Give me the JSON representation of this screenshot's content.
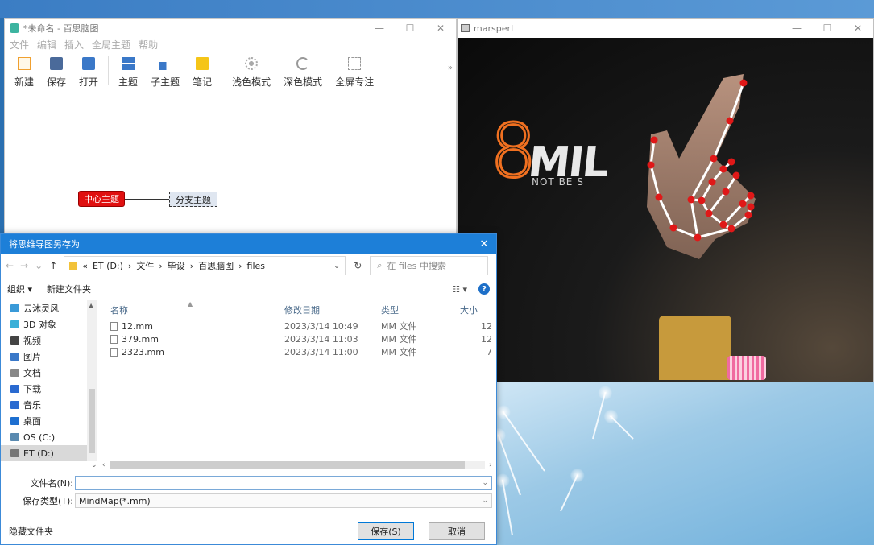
{
  "mindmap_window": {
    "title": "*未命名 - 百思脑图",
    "controls": {
      "minimize": "—",
      "maximize": "☐",
      "close": "✕"
    },
    "menu": [
      "文件",
      "编辑",
      "插入",
      "全局主题",
      "帮助"
    ],
    "toolbar": {
      "new": "新建",
      "save": "保存",
      "open": "打开",
      "topic": "主题",
      "subtopic": "子主题",
      "note": "笔记",
      "light": "浅色模式",
      "dark": "深色模式",
      "fullscreen": "全屏专注",
      "more": "»"
    },
    "nodes": {
      "main": "中心主题",
      "branch": "分支主题"
    }
  },
  "camera_window": {
    "title": "marsperL",
    "controls": {
      "minimize": "—",
      "maximize": "☐",
      "close": "✕"
    },
    "digit": "8",
    "shirt_text": "MIL",
    "shirt_sub": "NOT BE S"
  },
  "save_dialog": {
    "title": "将思维导图另存为",
    "close": "✕",
    "address": {
      "prefix": "«",
      "crumbs": [
        "ET (D:)",
        "文件",
        "毕设",
        "百思脑图",
        "files"
      ],
      "sep": "›"
    },
    "search_placeholder": "在 files 中搜索",
    "organize": "组织 ▾",
    "new_folder": "新建文件夹",
    "nav_items": [
      {
        "label": "云沐灵风",
        "color": "#3a9ad8"
      },
      {
        "label": "3D 对象",
        "color": "#3ab0d8"
      },
      {
        "label": "视频",
        "color": "#444444"
      },
      {
        "label": "图片",
        "color": "#3a78c8"
      },
      {
        "label": "文档",
        "color": "#888888"
      },
      {
        "label": "下载",
        "color": "#2a6ad0"
      },
      {
        "label": "音乐",
        "color": "#2a6ad0"
      },
      {
        "label": "桌面",
        "color": "#1e6fd0"
      },
      {
        "label": "OS (C:)",
        "color": "#5a8ab0"
      },
      {
        "label": "ET (D:)",
        "color": "#777777"
      }
    ],
    "columns": {
      "name": "名称",
      "date": "修改日期",
      "type": "类型",
      "size": "大小"
    },
    "files": [
      {
        "name": "12.mm",
        "date": "2023/3/14 10:49",
        "type": "MM 文件",
        "size": "12"
      },
      {
        "name": "379.mm",
        "date": "2023/3/14 11:03",
        "type": "MM 文件",
        "size": "12"
      },
      {
        "name": "2323.mm",
        "date": "2023/3/14 11:00",
        "type": "MM 文件",
        "size": "7"
      }
    ],
    "filename_label": "文件名(N):",
    "filename_value": "",
    "filetype_label": "保存类型(T):",
    "filetype_value": "MindMap(*.mm)",
    "hide_folders": "隐藏文件夹",
    "save_button": "保存(S)",
    "cancel_button": "取消"
  }
}
